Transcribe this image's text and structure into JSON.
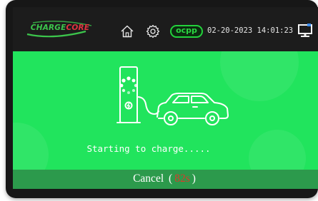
{
  "header": {
    "logo_prefix": "CHARGE",
    "logo_suffix": "CORE",
    "home_icon": "home-icon",
    "settings_icon": "gear-icon",
    "protocol_badge": "ocpp",
    "datetime": "02-20-2023 14:01:23",
    "status_icon": "monitor-icon"
  },
  "main": {
    "illustration": "ev-charging-illustration",
    "status": "Starting to charge.....",
    "cancel": {
      "label": "Cancel",
      "open": "(",
      "countdown": "82s",
      "close": ")"
    }
  },
  "colors": {
    "panel": "#21e45d",
    "cancel_bar": "#2c9a4c",
    "countdown": "#d83b2a",
    "ocpp": "#2bd642",
    "logo_green": "#3cc54c",
    "logo_red": "#e0343f"
  }
}
